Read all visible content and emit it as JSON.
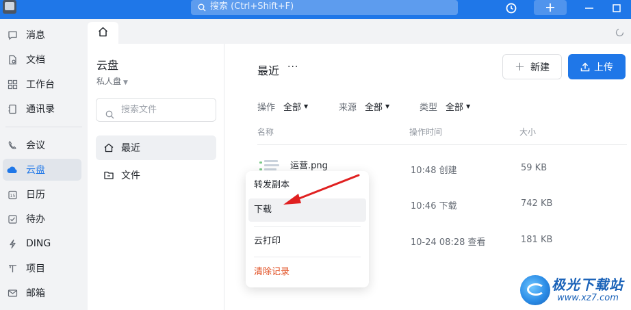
{
  "topbar": {
    "search_placeholder": "搜索 (Ctrl+Shift+F)",
    "add_label": "+",
    "min_label": "—",
    "max_label": "□"
  },
  "nav": {
    "items": [
      {
        "label": "消息",
        "icon": "message-icon"
      },
      {
        "label": "文档",
        "icon": "doc-icon"
      },
      {
        "label": "工作台",
        "icon": "workbench-icon"
      },
      {
        "label": "通讯录",
        "icon": "contacts-icon"
      },
      {
        "label": "会议",
        "icon": "meeting-icon"
      },
      {
        "label": "云盘",
        "icon": "cloud-icon",
        "active": true
      },
      {
        "label": "日历",
        "icon": "calendar-icon"
      },
      {
        "label": "待办",
        "icon": "todo-icon"
      },
      {
        "label": "DING",
        "icon": "ding-icon"
      },
      {
        "label": "项目",
        "icon": "project-icon"
      },
      {
        "label": "邮箱",
        "icon": "mail-icon"
      }
    ]
  },
  "drive": {
    "title": "云盘",
    "subtitle": "私人盘",
    "search_placeholder": "搜索文件",
    "menu": [
      {
        "label": "最近",
        "icon": "home-icon"
      },
      {
        "label": "文件",
        "icon": "folder-icon"
      }
    ]
  },
  "main": {
    "section_title": "最近",
    "more_label": "···",
    "new_label": "新建",
    "upload_label": "上传",
    "filters": [
      {
        "label": "操作",
        "value": "全部"
      },
      {
        "label": "来源",
        "value": "全部"
      },
      {
        "label": "类型",
        "value": "全部"
      }
    ],
    "columns": [
      "名称",
      "操作时间",
      "大小"
    ],
    "rows": [
      {
        "name": "运营.png",
        "time": "10:48 创建",
        "size": "59 KB"
      },
      {
        "name": "",
        "time": "10:46 下载",
        "size": "742 KB"
      },
      {
        "name": "",
        "time": "10-24 08:28 查看",
        "size": "181 KB"
      }
    ]
  },
  "context_menu": {
    "items": [
      "转发副本",
      "下载",
      "云打印",
      "清除记录"
    ]
  },
  "watermark": {
    "brand": "极光下载站",
    "url": "www.xz7.com"
  },
  "colors": {
    "accent": "#1f77e8",
    "danger": "#e0491b",
    "arrow": "#e02020"
  }
}
